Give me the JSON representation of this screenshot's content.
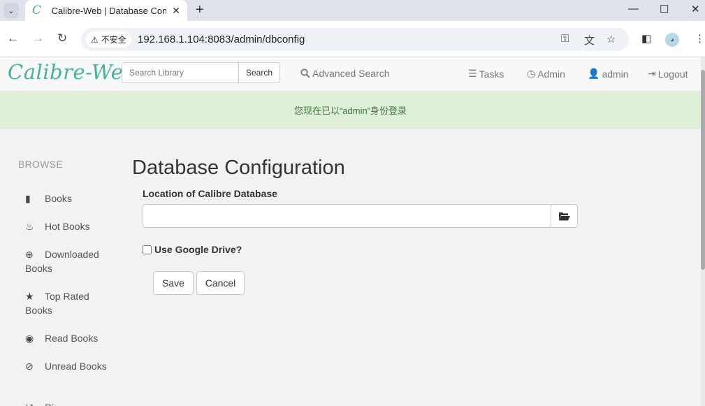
{
  "browser": {
    "tab_title": "Calibre-Web | Database Config",
    "security_label": "不安全",
    "url": "192.168.1.104:8083/admin/dbconfig"
  },
  "navbar": {
    "logo": "Calibre-Web",
    "search_placeholder": "Search Library",
    "search_button": "Search",
    "advanced_search": "Advanced Search",
    "tasks": "Tasks",
    "admin": "Admin",
    "user": "admin",
    "logout": "Logout"
  },
  "flash": {
    "message": "您现在已以“admin”身份登录"
  },
  "sidebar": {
    "title": "BROWSE",
    "items": [
      {
        "label": "Books",
        "icon": "book-icon"
      },
      {
        "label": "Hot Books",
        "icon": "fire-icon"
      },
      {
        "label": "Downloaded Books",
        "icon": "download-icon"
      },
      {
        "label": "Top Rated Books",
        "icon": "star-icon"
      },
      {
        "label": "Read Books",
        "icon": "eye-icon"
      },
      {
        "label": "Unread Books",
        "icon": "eye-slash-icon"
      },
      {
        "label": "Di",
        "icon": "random-icon"
      }
    ]
  },
  "main": {
    "title": "Database Configuration",
    "location_label": "Location of Calibre Database",
    "location_value": "",
    "gdrive_label": "Use Google Drive?",
    "gdrive_checked": false,
    "save": "Save",
    "cancel": "Cancel"
  },
  "colors": {
    "brand": "#45b29d",
    "flash_bg": "#dff0d8",
    "flash_text": "#3c763d"
  }
}
